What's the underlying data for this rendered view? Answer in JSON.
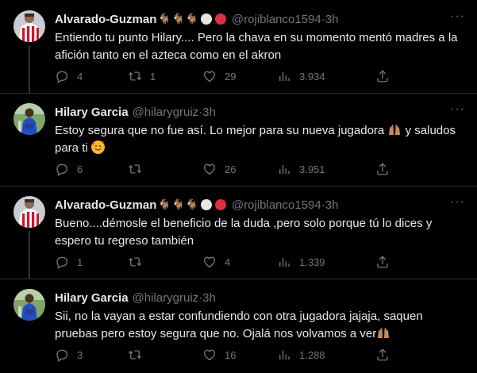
{
  "tweets": [
    {
      "name": "Alvarado-Guzman",
      "handle": "@rojiblanco1594",
      "time": "3h",
      "text": "Entiendo tu punto Hilary.... Pero la chava en su momento mentó madres a la afición tanto en el azteca como en el akron",
      "reply_count": "4",
      "retweet_count": "1",
      "like_count": "29",
      "view_count": "3.934"
    },
    {
      "name": "Hilary Garcia",
      "handle": "@hilarygruiz",
      "time": "3h",
      "text": "Estoy segura que no fue así. Lo mejor para su nueva jugadora",
      "text_after": " y saludos para ti",
      "reply_count": "6",
      "retweet_count": "",
      "like_count": "26",
      "view_count": "3.951"
    },
    {
      "name": "Alvarado-Guzman",
      "handle": "@rojiblanco1594",
      "time": "3h",
      "text": "Bueno....démosle el beneficio de la duda ,pero solo porque tú lo dices y espero tu regreso también",
      "reply_count": "1",
      "retweet_count": "",
      "like_count": "4",
      "view_count": "1.339"
    },
    {
      "name": "Hilary Garcia",
      "handle": "@hilarygruiz",
      "time": "3h",
      "text": "Sii, no la vayan a estar confundiendo con otra jugadora jajaja, saquen pruebas pero estoy segura que no. Ojalá nos volvamos a ver",
      "reply_count": "3",
      "retweet_count": "",
      "like_count": "16",
      "view_count": "1.288"
    }
  ],
  "separator": " · ",
  "colors": {
    "background": "#000000",
    "text": "#e7e9ea",
    "muted": "#71767b",
    "divider": "#2f3336",
    "chivas_red": "#d7102b"
  },
  "icons": {
    "reply": "reply-icon",
    "retweet": "retweet-icon",
    "like": "heart-icon",
    "views": "analytics-icon",
    "share": "share-icon",
    "more": "more-icon"
  }
}
